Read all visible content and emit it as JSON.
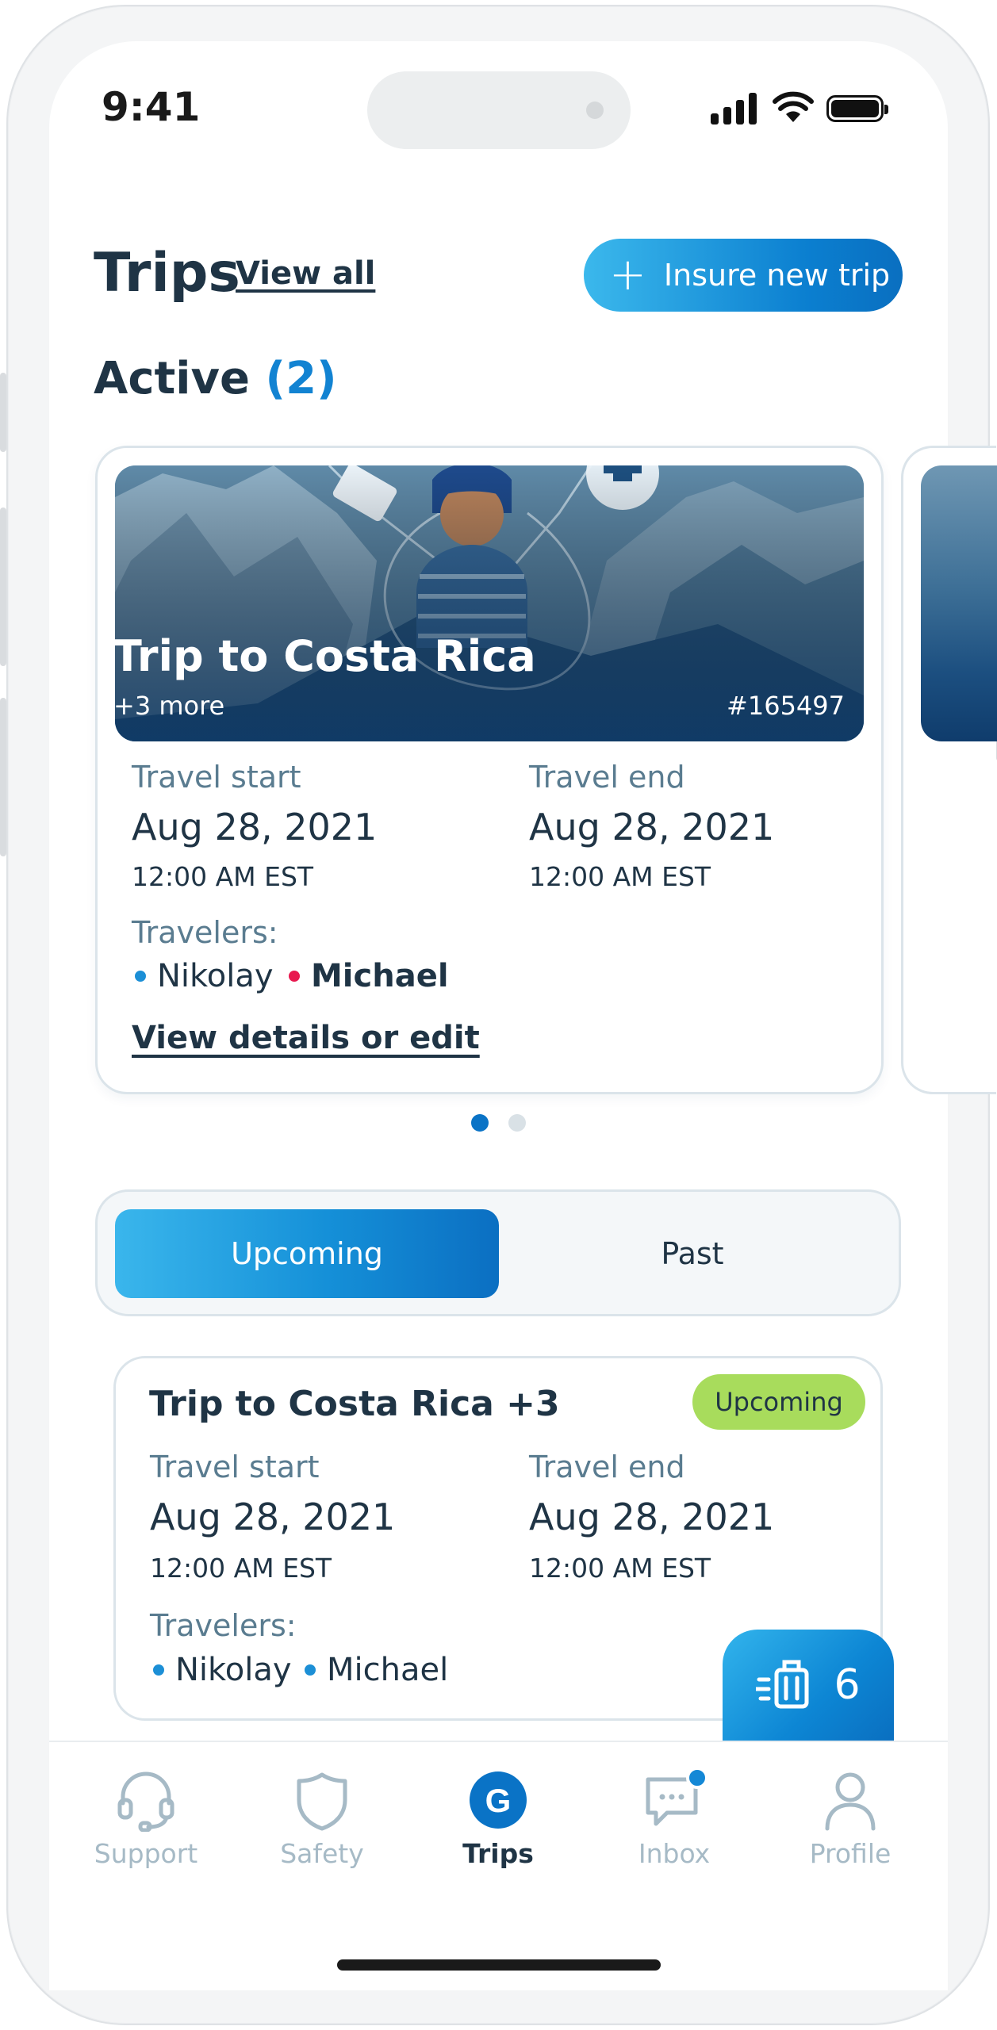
{
  "status_bar": {
    "time": "9:41"
  },
  "header": {
    "title": "Trips",
    "view_all": "View all",
    "insure_button": "Insure new trip"
  },
  "active_section": {
    "label": "Active",
    "count": "(2)"
  },
  "active_card": {
    "title": "Trip to Costa Rica",
    "more": "+3 more",
    "id": "#165497",
    "travel_start_label": "Travel start",
    "travel_start_date": "Aug 28, 2021",
    "travel_start_time": "12:00 AM EST",
    "travel_end_label": "Travel end",
    "travel_end_date": "Aug 28, 2021",
    "travel_end_time": "12:00 AM EST",
    "travelers_label": "Travelers:",
    "travelers": [
      {
        "name": "Nikolay",
        "color": "#1c8fd6"
      },
      {
        "name": "Michael",
        "color": "#e8194f"
      }
    ],
    "details_link": "View details or edit"
  },
  "pager": {
    "active_color": "#0a73c6",
    "inactive_color": "#d9e1e6"
  },
  "segmented": {
    "upcoming": "Upcoming",
    "past": "Past"
  },
  "upcoming_card": {
    "title": "Trip to Costa Rica +3",
    "badge": "Upcoming",
    "travel_start_label": "Travel start",
    "travel_start_date": "Aug 28, 2021",
    "travel_start_time": "12:00 AM EST",
    "travel_end_label": "Travel end",
    "travel_end_date": "Aug 28, 2021",
    "travel_end_time": "12:00 AM EST",
    "travelers_label": "Travelers:",
    "travelers": [
      {
        "name": "Nikolay",
        "color": "#1c8fd6"
      },
      {
        "name": "Michael",
        "color": "#1c8fd6"
      }
    ]
  },
  "fab": {
    "icon": "luggage-icon",
    "count": "6"
  },
  "tabs": [
    {
      "label": "Support",
      "icon": "headset-icon",
      "active": false
    },
    {
      "label": "Safety",
      "icon": "shield-icon",
      "active": false
    },
    {
      "label": "Trips",
      "icon": "g-logo-icon",
      "active": true
    },
    {
      "label": "Inbox",
      "icon": "chat-icon",
      "active": false,
      "notification": true
    },
    {
      "label": "Profile",
      "icon": "person-icon",
      "active": false
    }
  ],
  "colors": {
    "brand_blue": "#0b7fd0",
    "text_dark": "#1f3445",
    "badge_green": "#a8dc5c",
    "muted": "#a6bac6"
  }
}
